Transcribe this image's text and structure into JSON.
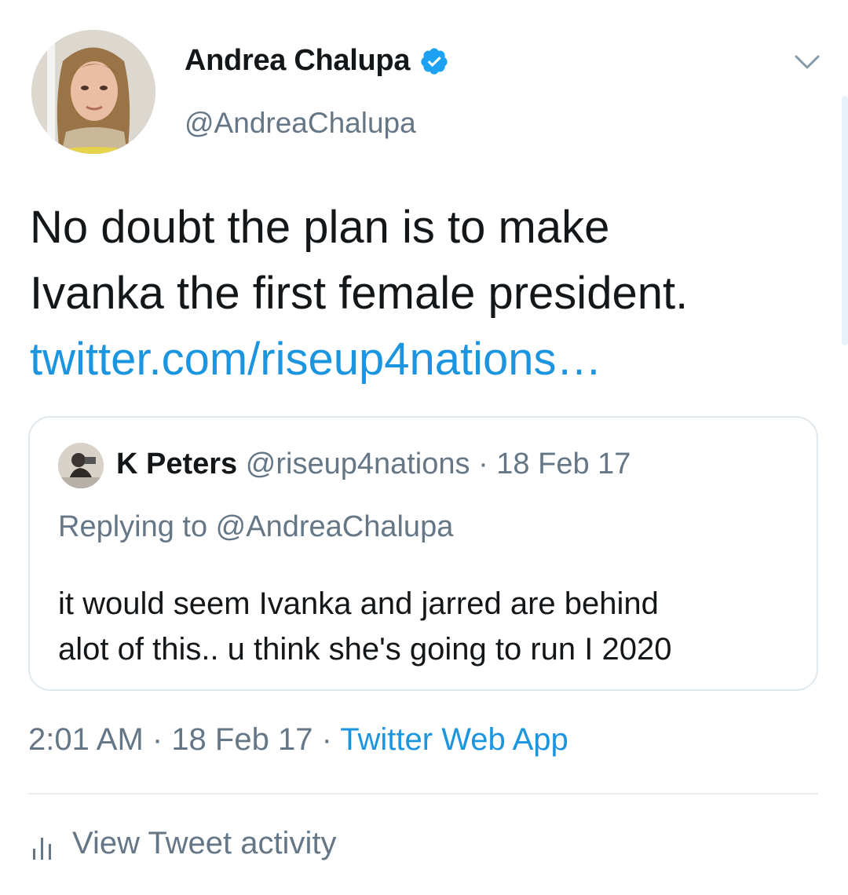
{
  "author": {
    "name": "Andrea Chalupa",
    "handle": "@AndreaChalupa",
    "verified": true,
    "avatar_icon": "profile-photo"
  },
  "tweet": {
    "text_lines": [
      "No doubt the plan is to make",
      "Ivanka the first female president."
    ],
    "link": "twitter.com/riseup4nations…"
  },
  "quoted_tweet": {
    "name": "K Peters",
    "handle": "@riseup4nations",
    "separator": " · ",
    "date": "18 Feb 17",
    "replying_to": "Replying to @AndreaChalupa",
    "text_lines": [
      "it would seem Ivanka and jarred are behind",
      "alot of this.. u think she's going to run I  2020"
    ]
  },
  "meta": {
    "time": "2:01 AM",
    "separator": " · ",
    "date": "18 Feb 17",
    "source": "Twitter Web App"
  },
  "activity": {
    "label": "View Tweet activity",
    "icon": "bar-chart-icon"
  },
  "colors": {
    "link": "#1b95e0",
    "secondary_text": "#657786",
    "primary_text": "#14171a",
    "border": "#e1e8ed"
  }
}
